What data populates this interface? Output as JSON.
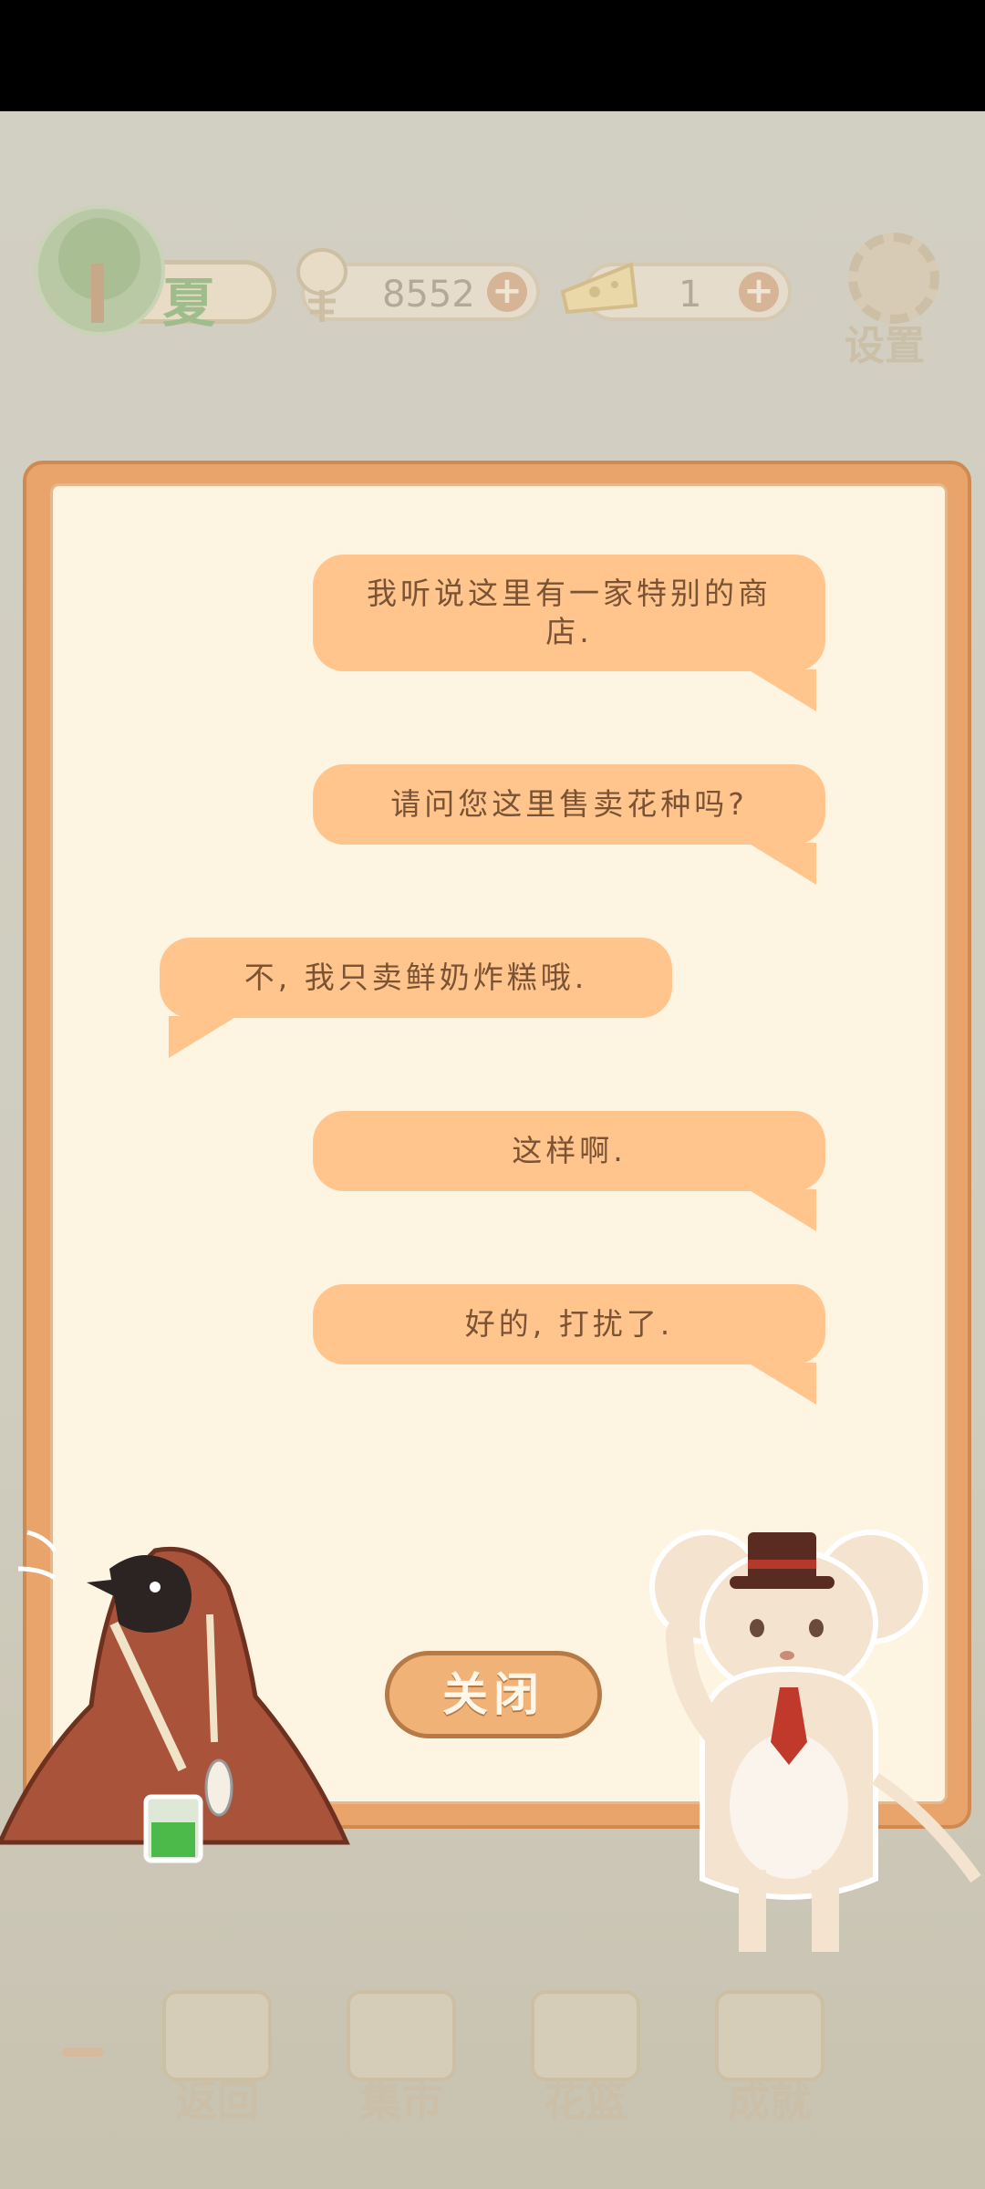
{
  "header": {
    "season": "夏",
    "fish_count": "8552",
    "cheese_count": "1",
    "plus_symbol": "+",
    "settings_label": "设置"
  },
  "dialog": {
    "messages": [
      {
        "speaker": "right",
        "text_line1": "我听说这里有一家特别的商",
        "text_line2": "店."
      },
      {
        "speaker": "right",
        "text": "请问您这里售卖花种吗?"
      },
      {
        "speaker": "left",
        "text": "不, 我只卖鲜奶炸糕哦."
      },
      {
        "speaker": "right",
        "text": "这样啊."
      },
      {
        "speaker": "right",
        "text": "好的, 打扰了."
      }
    ],
    "close_label": "关闭"
  },
  "bottom_nav": {
    "items": [
      {
        "label": "返回",
        "icon": "window-icon"
      },
      {
        "label": "集市",
        "icon": "market-stall-icon"
      },
      {
        "label": "花篮",
        "icon": "flower-basket-icon"
      },
      {
        "label": "成就",
        "icon": "trophy-icon"
      }
    ]
  },
  "colors": {
    "bubble": "#ffc58d",
    "dialog_frame": "#e9a46b",
    "dialog_bg": "#fdf5e1",
    "text": "#7a5234"
  }
}
